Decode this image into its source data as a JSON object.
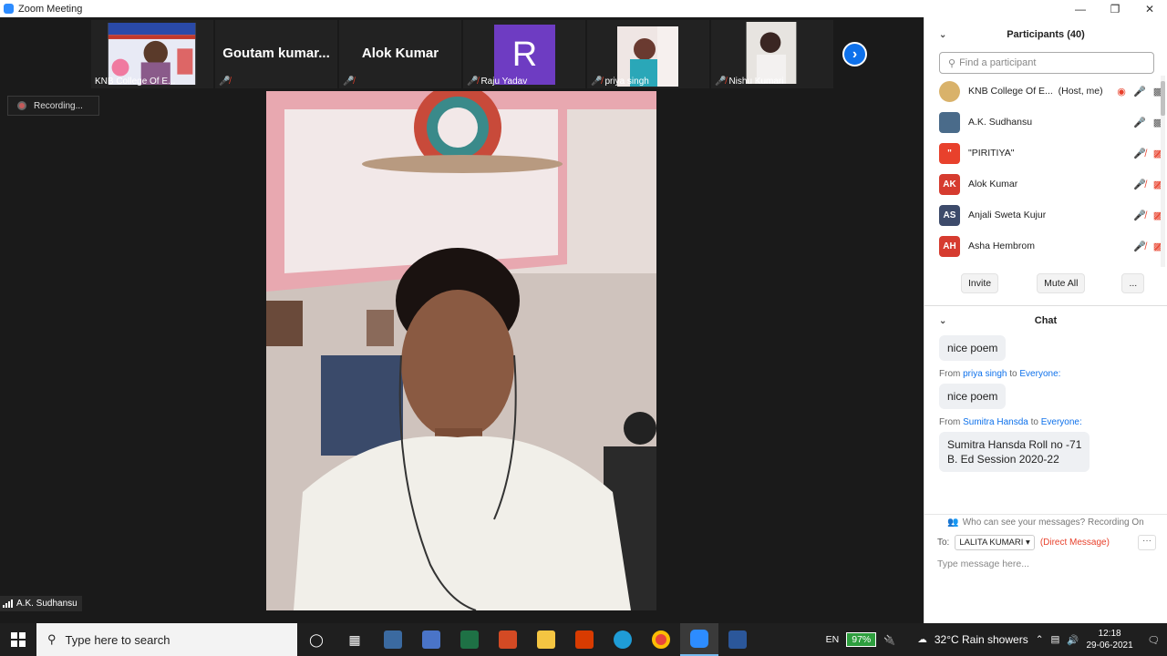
{
  "window": {
    "title": "Zoom Meeting"
  },
  "strip": {
    "tiles": [
      {
        "name": "KNB College Of E...",
        "big": ""
      },
      {
        "name": "",
        "big": "Goutam  kumar..."
      },
      {
        "name": "",
        "big": "Alok Kumar"
      },
      {
        "name": "Raju Yadav",
        "big": "R"
      },
      {
        "name": "priya singh",
        "big": ""
      },
      {
        "name": "Nishu Kumari",
        "big": ""
      }
    ]
  },
  "recording": {
    "label": "Recording..."
  },
  "speaker": {
    "name": "A.K. Sudhansu"
  },
  "participants": {
    "header": "Participants (40)",
    "search_placeholder": "Find a participant",
    "list": [
      {
        "initials": "",
        "name": "KNB College Of E...",
        "role": "(Host, me)",
        "color": "#d9b26a"
      },
      {
        "initials": "",
        "name": "A.K. Sudhansu",
        "role": "",
        "color": "#4a6b8a"
      },
      {
        "initials": "\"",
        "name": "\"PIRITIYA\"",
        "role": "",
        "color": "#e8412c"
      },
      {
        "initials": "AK",
        "name": "Alok Kumar",
        "role": "",
        "color": "#d63b2f"
      },
      {
        "initials": "AS",
        "name": "Anjali Sweta Kujur",
        "role": "",
        "color": "#3d4b6b"
      },
      {
        "initials": "AH",
        "name": "Asha Hembrom",
        "role": "",
        "color": "#d63b2f"
      }
    ],
    "invite_label": "Invite",
    "mute_all_label": "Mute All",
    "more_label": "..."
  },
  "chat": {
    "header": "Chat",
    "messages": [
      {
        "from": "",
        "to": "",
        "text": "nice poem"
      },
      {
        "from": "priya singh",
        "to": "Everyone:",
        "text": "nice poem"
      },
      {
        "from": "Sumitra Hansda",
        "to": "Everyone:",
        "text": "Sumitra Hansda Roll no -71\nB. Ed Session 2020-22"
      }
    ],
    "from_word": "From",
    "to_word": "to",
    "who_can_see": "Who can see your messages? Recording On",
    "to_label": "To:",
    "recipient": "LALITA KUMARI",
    "dm_label": "(Direct Message)",
    "input_placeholder": "Type message here..."
  },
  "taskbar": {
    "search_placeholder": "Type here to search",
    "lang": "EN",
    "battery": "97%",
    "weather": "32°C  Rain showers",
    "time": "12:18",
    "date": "29-06-2021"
  }
}
